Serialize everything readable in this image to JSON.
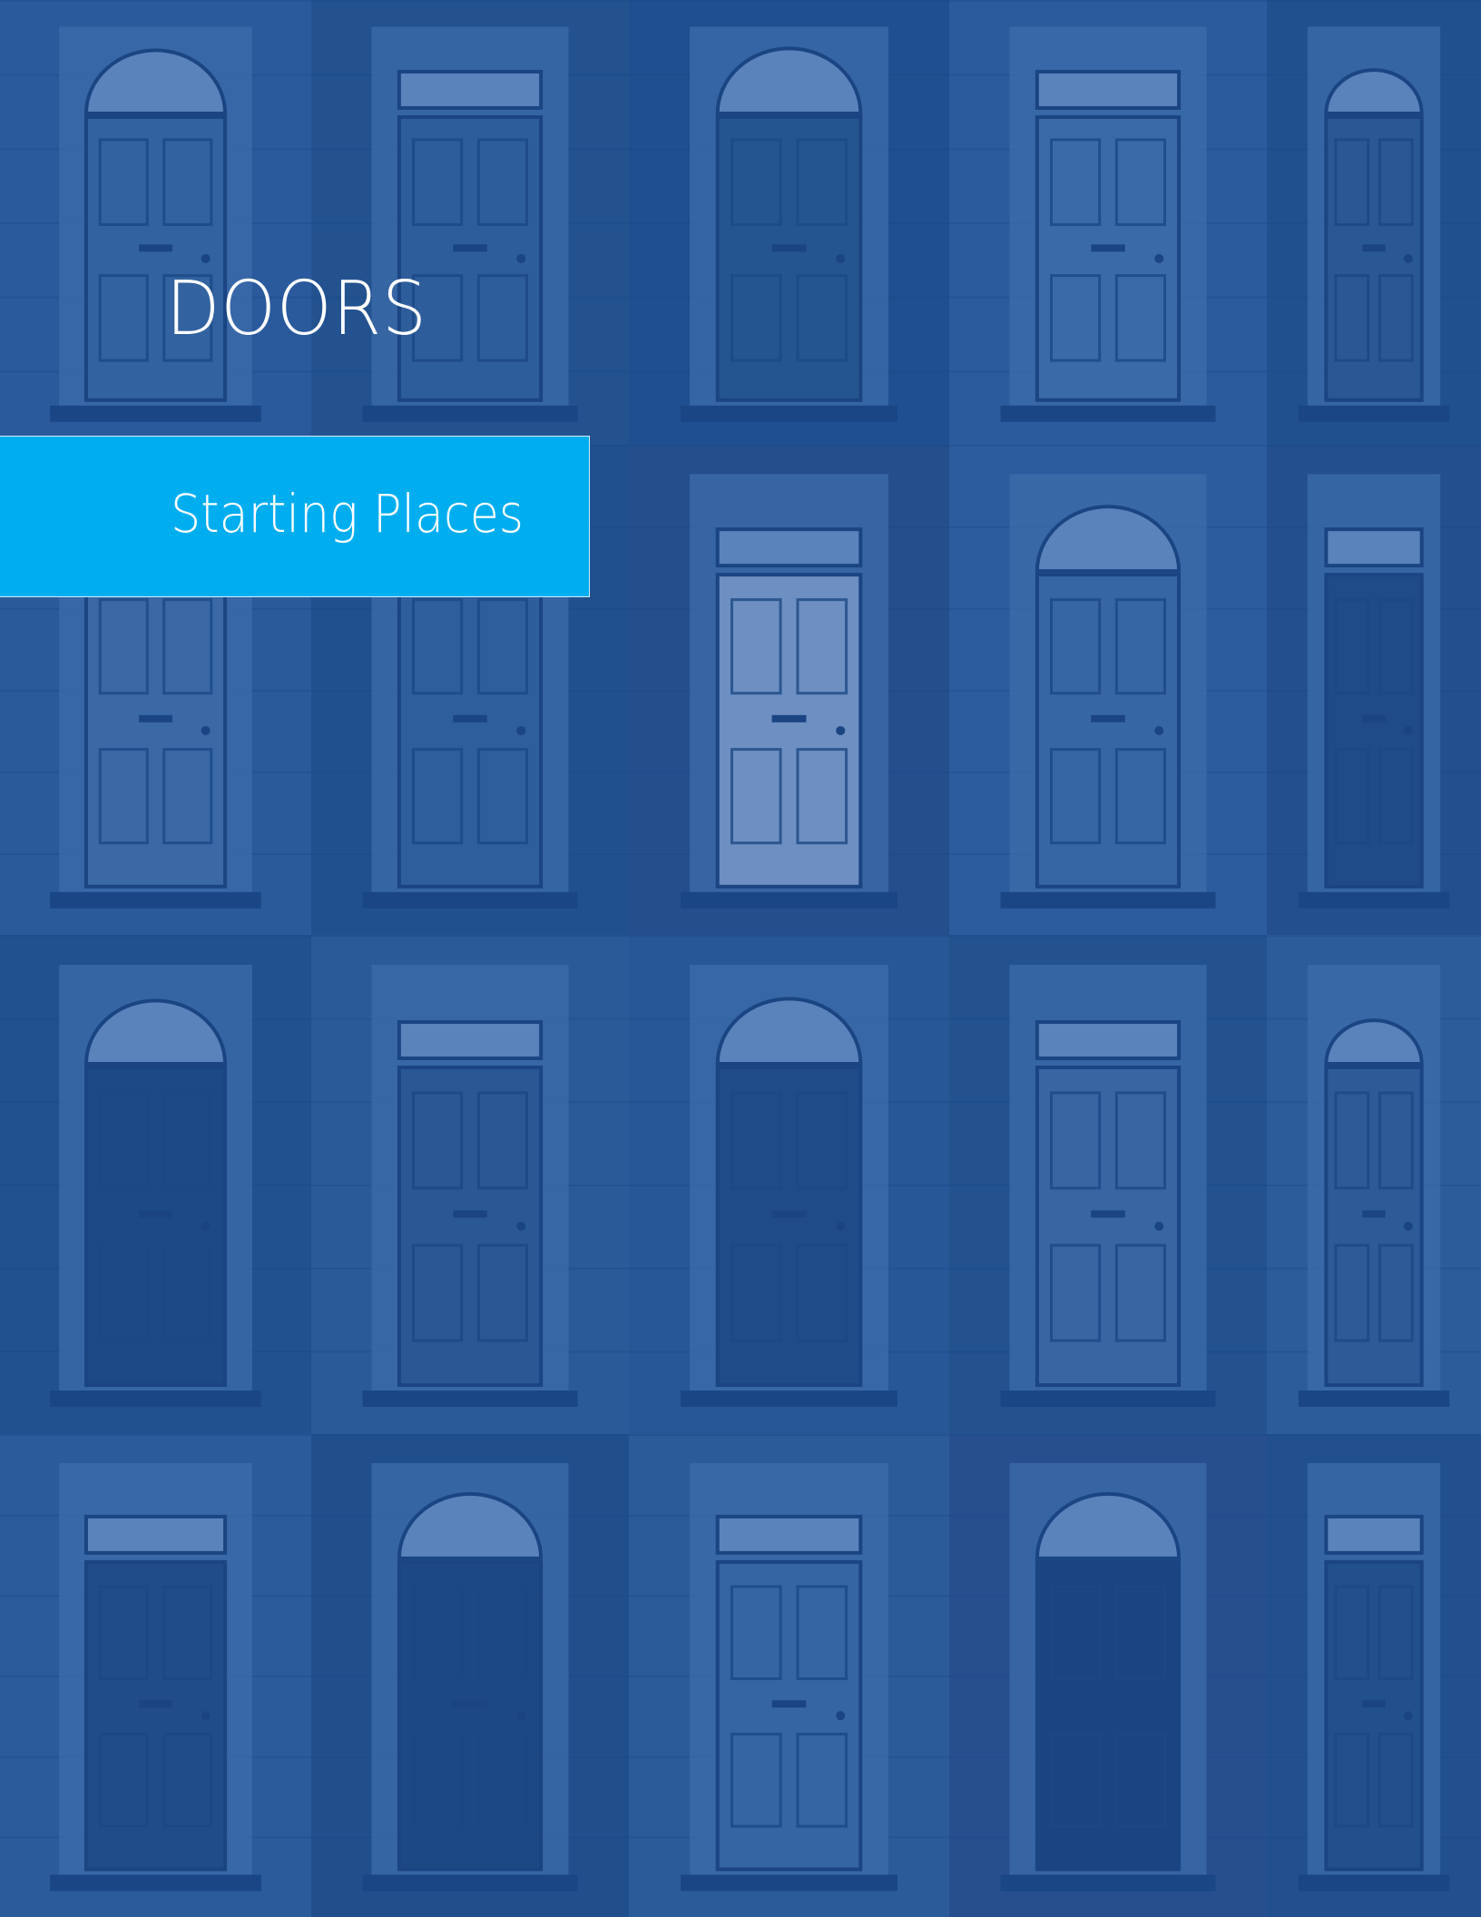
{
  "cover": {
    "title": "DOORS",
    "subtitle": "Starting Places"
  },
  "colors": {
    "background": "#1d4e92",
    "accent_band": "#00aeef",
    "text": "#ffffff"
  },
  "image": {
    "subject": "collage of front doors",
    "rows": 4,
    "columns": 5
  }
}
